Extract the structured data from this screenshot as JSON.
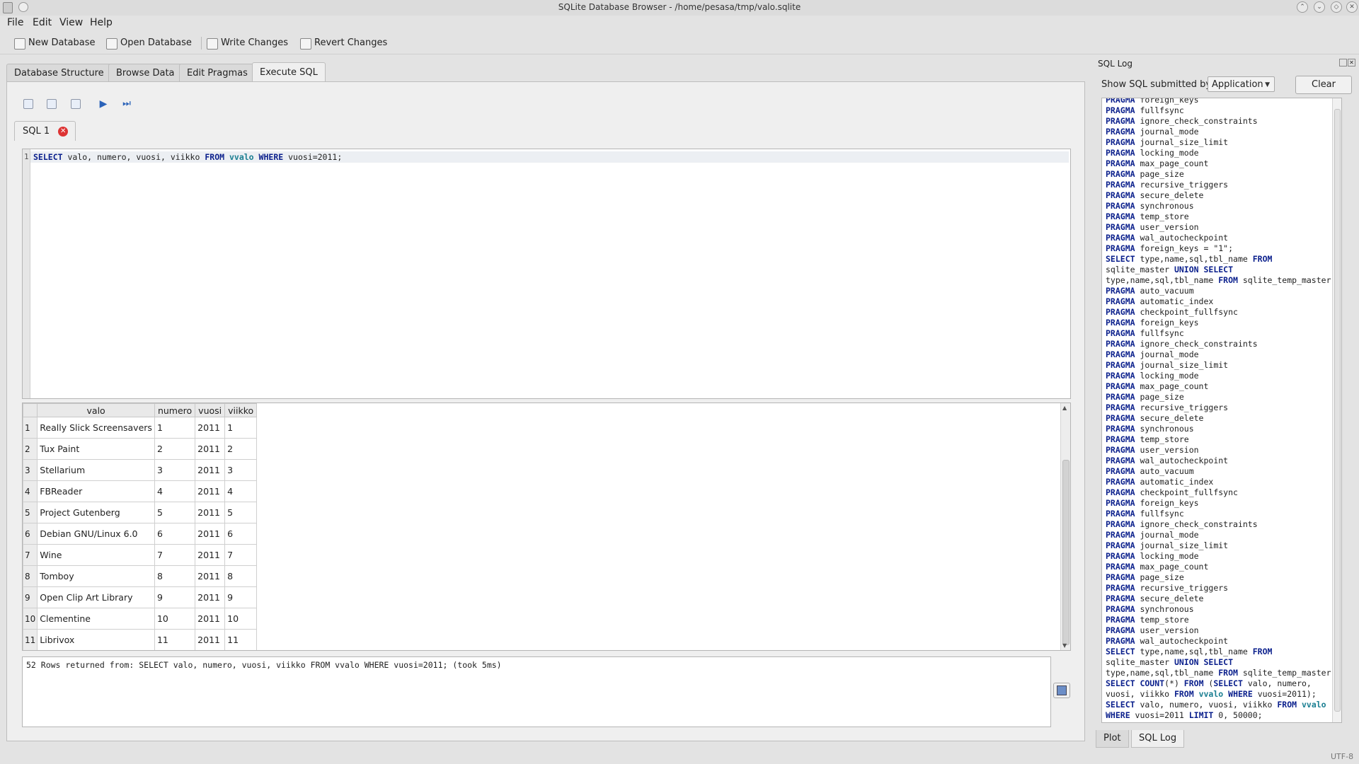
{
  "window": {
    "title": "SQLite Database Browser - /home/pesasa/tmp/valo.sqlite",
    "buttons": [
      "minimize",
      "maximize",
      "restore",
      "close"
    ]
  },
  "menu": {
    "items": [
      {
        "label": "File"
      },
      {
        "label": "Edit"
      },
      {
        "label": "View"
      },
      {
        "label": "Help"
      }
    ]
  },
  "toolbar": {
    "new_database": "New Database",
    "open_database": "Open Database",
    "write_changes": "Write Changes",
    "revert_changes": "Revert Changes"
  },
  "tabs": [
    "Database Structure",
    "Browse Data",
    "Edit Pragmas",
    "Execute SQL"
  ],
  "active_tab": "Execute SQL",
  "sql_editor": {
    "tab_label": "SQL 1",
    "line_number": "1",
    "tokens": [
      {
        "t": "SELECT",
        "c": "kw"
      },
      {
        "t": " valo, numero, vuosi, viikko ",
        "c": "str"
      },
      {
        "t": "FROM",
        "c": "kw"
      },
      {
        "t": " ",
        "c": "str"
      },
      {
        "t": "vvalo",
        "c": "tbl"
      },
      {
        "t": " ",
        "c": "str"
      },
      {
        "t": "WHERE",
        "c": "kw"
      },
      {
        "t": " vuosi=2011;",
        "c": "str"
      }
    ]
  },
  "results": {
    "columns": [
      "valo",
      "numero",
      "vuosi",
      "viikko"
    ],
    "rows": [
      [
        "1",
        "Really Slick Screensavers",
        "1",
        "2011",
        "1"
      ],
      [
        "2",
        "Tux Paint",
        "2",
        "2011",
        "2"
      ],
      [
        "3",
        "Stellarium",
        "3",
        "2011",
        "3"
      ],
      [
        "4",
        "FBReader",
        "4",
        "2011",
        "4"
      ],
      [
        "5",
        "Project Gutenberg",
        "5",
        "2011",
        "5"
      ],
      [
        "6",
        "Debian GNU/Linux 6.0",
        "6",
        "2011",
        "6"
      ],
      [
        "7",
        "Wine",
        "7",
        "2011",
        "7"
      ],
      [
        "8",
        "Tomboy",
        "8",
        "2011",
        "8"
      ],
      [
        "9",
        "Open Clip Art Library",
        "9",
        "2011",
        "9"
      ],
      [
        "10",
        "Clementine",
        "10",
        "2011",
        "10"
      ],
      [
        "11",
        "Librivox",
        "11",
        "2011",
        "11"
      ]
    ]
  },
  "message": "52 Rows returned from: SELECT valo, numero, vuosi, viikko FROM vvalo WHERE vuosi=2011; (took 5ms)",
  "sql_log": {
    "title": "SQL Log",
    "filter_label": "Show SQL submitted by",
    "filter_value": "Application",
    "clear_label": "Clear",
    "lines": [
      [
        [
          "PRAGMA",
          "kw"
        ],
        [
          " foreign_keys",
          ""
        ]
      ],
      [
        [
          "PRAGMA",
          "kw"
        ],
        [
          " fullfsync",
          ""
        ]
      ],
      [
        [
          "PRAGMA",
          "kw"
        ],
        [
          " ignore_check_constraints",
          ""
        ]
      ],
      [
        [
          "PRAGMA",
          "kw"
        ],
        [
          " journal_mode",
          ""
        ]
      ],
      [
        [
          "PRAGMA",
          "kw"
        ],
        [
          " journal_size_limit",
          ""
        ]
      ],
      [
        [
          "PRAGMA",
          "kw"
        ],
        [
          " locking_mode",
          ""
        ]
      ],
      [
        [
          "PRAGMA",
          "kw"
        ],
        [
          " max_page_count",
          ""
        ]
      ],
      [
        [
          "PRAGMA",
          "kw"
        ],
        [
          " page_size",
          ""
        ]
      ],
      [
        [
          "PRAGMA",
          "kw"
        ],
        [
          " recursive_triggers",
          ""
        ]
      ],
      [
        [
          "PRAGMA",
          "kw"
        ],
        [
          " secure_delete",
          ""
        ]
      ],
      [
        [
          "PRAGMA",
          "kw"
        ],
        [
          " synchronous",
          ""
        ]
      ],
      [
        [
          "PRAGMA",
          "kw"
        ],
        [
          " temp_store",
          ""
        ]
      ],
      [
        [
          "PRAGMA",
          "kw"
        ],
        [
          " user_version",
          ""
        ]
      ],
      [
        [
          "PRAGMA",
          "kw"
        ],
        [
          " wal_autocheckpoint",
          ""
        ]
      ],
      [
        [
          "PRAGMA",
          "kw"
        ],
        [
          " foreign_keys = \"1\";",
          ""
        ]
      ],
      [
        [
          "SELECT",
          "kw"
        ],
        [
          " type,name,sql,tbl_name ",
          ""
        ],
        [
          "FROM",
          "kw"
        ]
      ],
      [
        [
          "sqlite_master ",
          ""
        ],
        [
          "UNION SELECT",
          "kw"
        ]
      ],
      [
        [
          "type,name,sql,tbl_name ",
          ""
        ],
        [
          "FROM",
          "kw"
        ],
        [
          " sqlite_temp_master;",
          ""
        ]
      ],
      [
        [
          "PRAGMA",
          "kw"
        ],
        [
          " auto_vacuum",
          ""
        ]
      ],
      [
        [
          "PRAGMA",
          "kw"
        ],
        [
          " automatic_index",
          ""
        ]
      ],
      [
        [
          "PRAGMA",
          "kw"
        ],
        [
          " checkpoint_fullfsync",
          ""
        ]
      ],
      [
        [
          "PRAGMA",
          "kw"
        ],
        [
          " foreign_keys",
          ""
        ]
      ],
      [
        [
          "PRAGMA",
          "kw"
        ],
        [
          " fullfsync",
          ""
        ]
      ],
      [
        [
          "PRAGMA",
          "kw"
        ],
        [
          " ignore_check_constraints",
          ""
        ]
      ],
      [
        [
          "PRAGMA",
          "kw"
        ],
        [
          " journal_mode",
          ""
        ]
      ],
      [
        [
          "PRAGMA",
          "kw"
        ],
        [
          " journal_size_limit",
          ""
        ]
      ],
      [
        [
          "PRAGMA",
          "kw"
        ],
        [
          " locking_mode",
          ""
        ]
      ],
      [
        [
          "PRAGMA",
          "kw"
        ],
        [
          " max_page_count",
          ""
        ]
      ],
      [
        [
          "PRAGMA",
          "kw"
        ],
        [
          " page_size",
          ""
        ]
      ],
      [
        [
          "PRAGMA",
          "kw"
        ],
        [
          " recursive_triggers",
          ""
        ]
      ],
      [
        [
          "PRAGMA",
          "kw"
        ],
        [
          " secure_delete",
          ""
        ]
      ],
      [
        [
          "PRAGMA",
          "kw"
        ],
        [
          " synchronous",
          ""
        ]
      ],
      [
        [
          "PRAGMA",
          "kw"
        ],
        [
          " temp_store",
          ""
        ]
      ],
      [
        [
          "PRAGMA",
          "kw"
        ],
        [
          " user_version",
          ""
        ]
      ],
      [
        [
          "PRAGMA",
          "kw"
        ],
        [
          " wal_autocheckpoint",
          ""
        ]
      ],
      [
        [
          "PRAGMA",
          "kw"
        ],
        [
          " auto_vacuum",
          ""
        ]
      ],
      [
        [
          "PRAGMA",
          "kw"
        ],
        [
          " automatic_index",
          ""
        ]
      ],
      [
        [
          "PRAGMA",
          "kw"
        ],
        [
          " checkpoint_fullfsync",
          ""
        ]
      ],
      [
        [
          "PRAGMA",
          "kw"
        ],
        [
          " foreign_keys",
          ""
        ]
      ],
      [
        [
          "PRAGMA",
          "kw"
        ],
        [
          " fullfsync",
          ""
        ]
      ],
      [
        [
          "PRAGMA",
          "kw"
        ],
        [
          " ignore_check_constraints",
          ""
        ]
      ],
      [
        [
          "PRAGMA",
          "kw"
        ],
        [
          " journal_mode",
          ""
        ]
      ],
      [
        [
          "PRAGMA",
          "kw"
        ],
        [
          " journal_size_limit",
          ""
        ]
      ],
      [
        [
          "PRAGMA",
          "kw"
        ],
        [
          " locking_mode",
          ""
        ]
      ],
      [
        [
          "PRAGMA",
          "kw"
        ],
        [
          " max_page_count",
          ""
        ]
      ],
      [
        [
          "PRAGMA",
          "kw"
        ],
        [
          " page_size",
          ""
        ]
      ],
      [
        [
          "PRAGMA",
          "kw"
        ],
        [
          " recursive_triggers",
          ""
        ]
      ],
      [
        [
          "PRAGMA",
          "kw"
        ],
        [
          " secure_delete",
          ""
        ]
      ],
      [
        [
          "PRAGMA",
          "kw"
        ],
        [
          " synchronous",
          ""
        ]
      ],
      [
        [
          "PRAGMA",
          "kw"
        ],
        [
          " temp_store",
          ""
        ]
      ],
      [
        [
          "PRAGMA",
          "kw"
        ],
        [
          " user_version",
          ""
        ]
      ],
      [
        [
          "PRAGMA",
          "kw"
        ],
        [
          " wal_autocheckpoint",
          ""
        ]
      ],
      [
        [
          "SELECT",
          "kw"
        ],
        [
          " type,name,sql,tbl_name ",
          ""
        ],
        [
          "FROM",
          "kw"
        ]
      ],
      [
        [
          "sqlite_master ",
          ""
        ],
        [
          "UNION SELECT",
          "kw"
        ]
      ],
      [
        [
          "type,name,sql,tbl_name ",
          ""
        ],
        [
          "FROM",
          "kw"
        ],
        [
          " sqlite_temp_master;",
          ""
        ]
      ],
      [
        [
          "SELECT COUNT",
          "kw"
        ],
        [
          "(*) ",
          ""
        ],
        [
          "FROM",
          "kw"
        ],
        [
          " (",
          ""
        ],
        [
          "SELECT",
          "kw"
        ],
        [
          " valo, numero,",
          ""
        ]
      ],
      [
        [
          "vuosi, viikko ",
          ""
        ],
        [
          "FROM",
          "kw"
        ],
        [
          " ",
          ""
        ],
        [
          "vvalo",
          "tbl"
        ],
        [
          " ",
          ""
        ],
        [
          "WHERE",
          "kw"
        ],
        [
          " vuosi=2011);",
          ""
        ]
      ],
      [
        [
          "SELECT",
          "kw"
        ],
        [
          " valo, numero, vuosi, viikko ",
          ""
        ],
        [
          "FROM",
          "kw"
        ],
        [
          " ",
          ""
        ],
        [
          "vvalo",
          "tbl"
        ]
      ],
      [
        [
          "WHERE",
          "kw"
        ],
        [
          " vuosi=2011 ",
          ""
        ],
        [
          "LIMIT",
          "kw"
        ],
        [
          " 0, 50000;",
          ""
        ]
      ]
    ]
  },
  "bottom_tabs": [
    "Plot",
    "SQL Log"
  ],
  "status": "UTF-8"
}
